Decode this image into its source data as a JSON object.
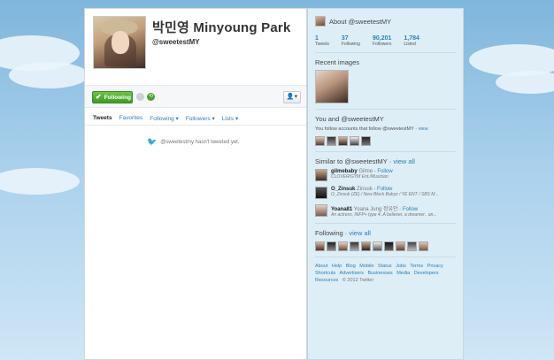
{
  "profile": {
    "name": "박민영 Minyoung Park",
    "screen_name": "@sweetestMY",
    "following_button": "Following",
    "empty_message": "@sweetestmy hasn't tweeted yet."
  },
  "tabs": [
    "Tweets",
    "Favorites",
    "Following ▾",
    "Followers ▾",
    "Lists ▾"
  ],
  "sidebar": {
    "about_title": "About @sweetestMY",
    "stats": [
      {
        "num": "1",
        "label": "Tweets"
      },
      {
        "num": "37",
        "label": "Following"
      },
      {
        "num": "90,201",
        "label": "Followers"
      },
      {
        "num": "1,784",
        "label": "Listed"
      }
    ],
    "recent_images_title": "Recent images",
    "you_and_title": "You and @sweetestMY",
    "you_follow_text": "You follow accounts that follow @sweetestMY ·",
    "view_link": "view",
    "similar_title": "Similar to @sweetestMY",
    "similar_view_all": "view all",
    "similar": [
      {
        "handle": "gilmebaby",
        "name": "Gilme",
        "follow": "Follow",
        "bio": "CLOVER/GYM Ent./Musician"
      },
      {
        "handle": "O_Zinsuk",
        "name": "Zinsuk",
        "follow": "Follow",
        "bio": "O_Zinsuk (ZE) / New Block Babyz / YE ENT / SBS M..."
      },
      {
        "handle": "Yoana81",
        "name": "Yoana Jung 정유안",
        "follow": "Follow",
        "bio": "An actress, INFP+ type 4..A believer, a dreamer.. an..."
      }
    ],
    "following_title": "Following",
    "following_view_all": "view all",
    "footer_links": [
      "About",
      "Help",
      "Blog",
      "Mobile",
      "Status",
      "Jobs",
      "Terms",
      "Privacy",
      "Shortcuts",
      "Advertisers",
      "Businesses",
      "Media",
      "Developers",
      "Resources"
    ],
    "copyright": "© 2012 Twitter"
  }
}
